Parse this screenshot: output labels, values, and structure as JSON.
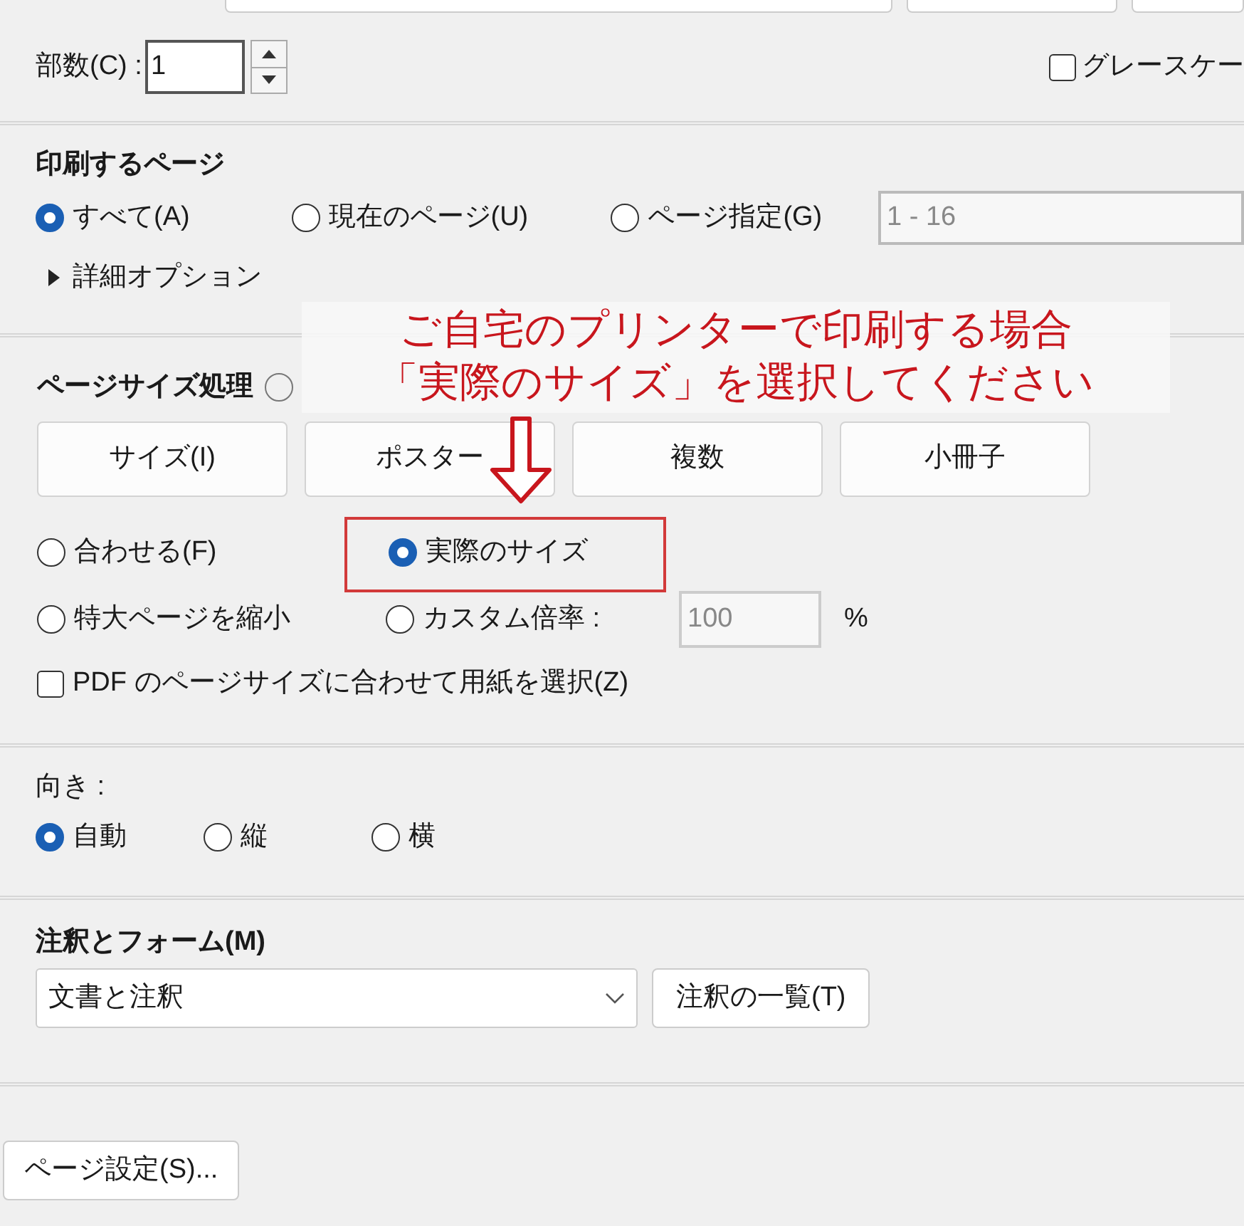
{
  "copies": {
    "label": "部数(C) :",
    "value": "1"
  },
  "grayscale": {
    "label": "グレースケー",
    "checked": false
  },
  "pages_to_print": {
    "heading": "印刷するページ",
    "options": [
      {
        "label": "すべて(A)",
        "selected": true
      },
      {
        "label": "現在のページ(U)",
        "selected": false
      },
      {
        "label": "ページ指定(G)",
        "selected": false
      }
    ],
    "range_value": "1 - 16",
    "more_options": {
      "label": "詳細オプション",
      "expanded": false
    }
  },
  "page_sizing": {
    "heading": "ページサイズ処理",
    "tabs": [
      "サイズ(I)",
      "ポスター",
      "複数",
      "小冊子"
    ],
    "options": [
      {
        "label": "合わせる(F)",
        "selected": false
      },
      {
        "label": "実際のサイズ",
        "selected": true
      },
      {
        "label": "特大ページを縮小",
        "selected": false
      },
      {
        "label": "カスタム倍率 :",
        "selected": false
      }
    ],
    "scale_value": "100",
    "scale_unit": "%",
    "paper_by_pdf": {
      "label": "PDF のページサイズに合わせて用紙を選択(Z)",
      "checked": false
    }
  },
  "orientation": {
    "heading": "向き :",
    "options": [
      {
        "label": "自動",
        "selected": true
      },
      {
        "label": "縦",
        "selected": false
      },
      {
        "label": "横",
        "selected": false
      }
    ]
  },
  "comments_forms": {
    "heading": "注釈とフォーム(M)",
    "value": "文書と注釈",
    "button": "注釈の一覧(T)"
  },
  "page_setup_button": "ページ設定(S)...",
  "annotation": {
    "lines": [
      "ご自宅のプリンターで印刷する場合",
      "「実際のサイズ」を選択してください"
    ]
  }
}
